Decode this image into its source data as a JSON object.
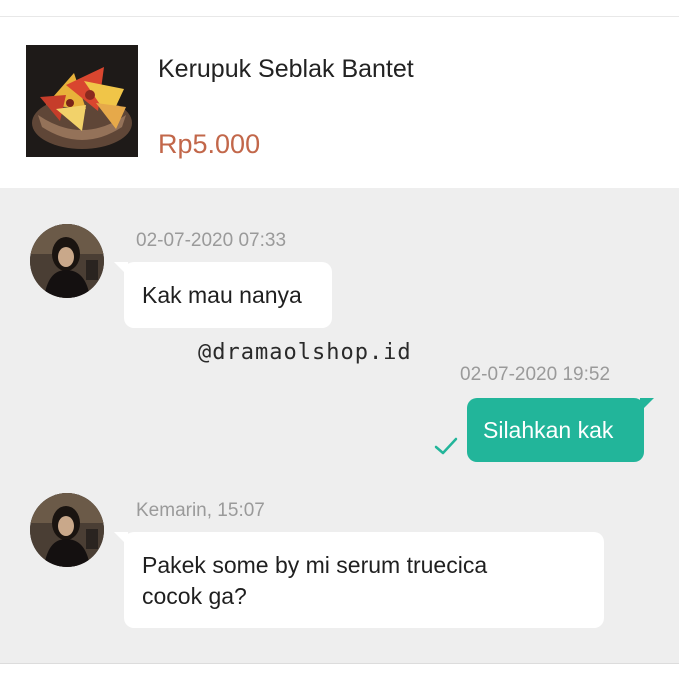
{
  "product": {
    "title": "Kerupuk Seblak Bantet",
    "price": "Rp5.000",
    "thumbnail": "seblak-crackers-bowl-photo"
  },
  "watermark": "@dramaolshop.id",
  "messages": [
    {
      "direction": "incoming",
      "timestamp": "02-07-2020 07:33",
      "text": "Kak mau nanya",
      "avatar": "user-avatar"
    },
    {
      "direction": "outgoing",
      "timestamp": "02-07-2020 19:52",
      "text": "Silahkan kak",
      "status_icon": "checkmark-icon"
    },
    {
      "direction": "incoming",
      "timestamp": "Kemarin, 15:07",
      "lines": [
        "Pakek some by mi serum truecica",
        "cocok ga?"
      ],
      "avatar": "user-avatar"
    }
  ],
  "colors": {
    "accent": "#22b59a",
    "price": "#c2674a",
    "chat_bg": "#eeeeee"
  }
}
